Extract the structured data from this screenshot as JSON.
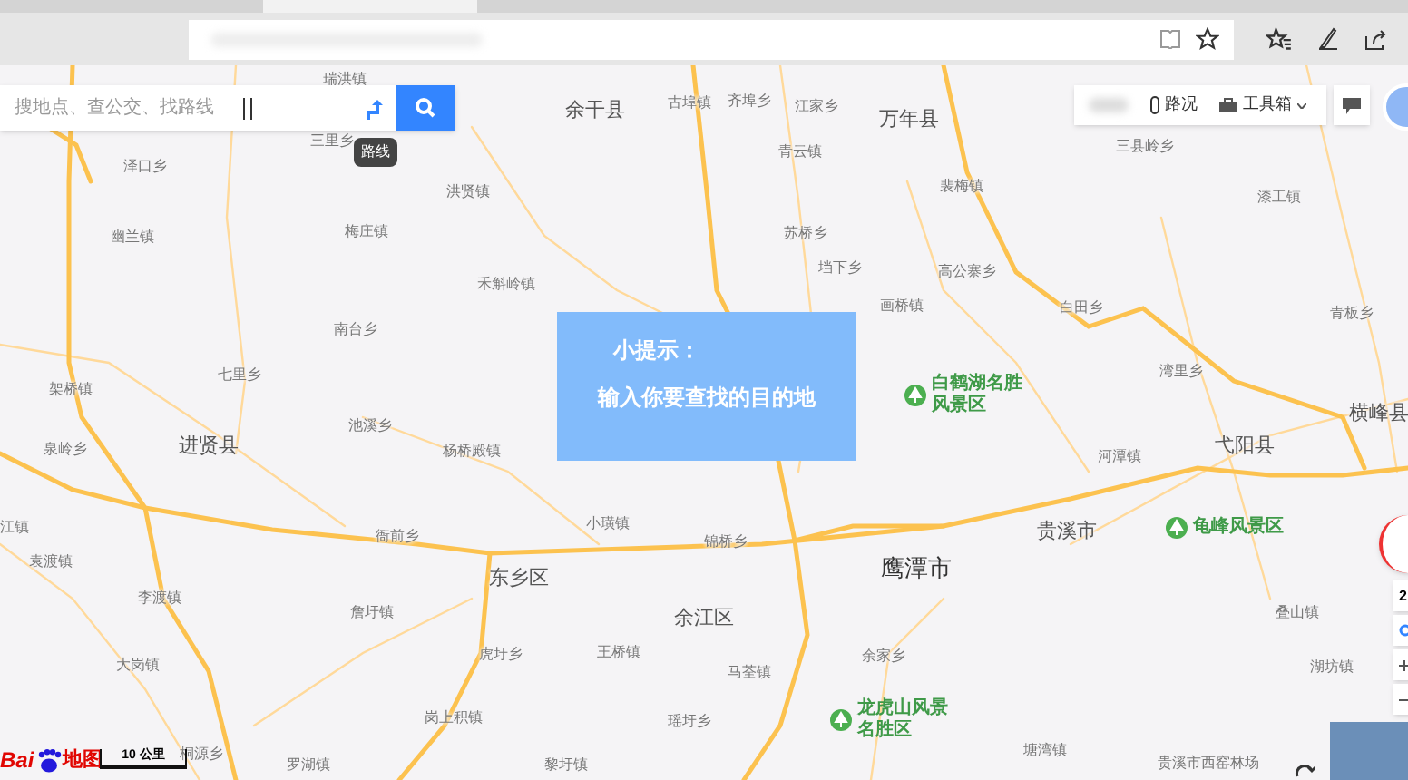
{
  "search": {
    "placeholder": "搜地点、查公交、找路线",
    "route_tooltip": "路线"
  },
  "top_panel": {
    "traffic": "路况",
    "toolbox": "工具箱"
  },
  "tip": {
    "title": "小提示：",
    "text": "输入你要查找的目的地"
  },
  "labels": [
    {
      "text": "瑞洪镇",
      "kind": "town"
    },
    {
      "text": "余干县",
      "kind": "county"
    },
    {
      "text": "古埠镇",
      "kind": "town"
    },
    {
      "text": "三里乡",
      "kind": "town"
    },
    {
      "text": "泽口乡",
      "kind": "town"
    },
    {
      "text": "洪贤镇",
      "kind": "town"
    },
    {
      "text": "幽兰镇",
      "kind": "town"
    },
    {
      "text": "梅庄镇",
      "kind": "town"
    },
    {
      "text": "齐埠乡",
      "kind": "town"
    },
    {
      "text": "江家乡",
      "kind": "town"
    },
    {
      "text": "万年县",
      "kind": "county"
    },
    {
      "text": "青云镇",
      "kind": "town"
    },
    {
      "text": "裴梅镇",
      "kind": "town"
    },
    {
      "text": "苏桥乡",
      "kind": "town"
    },
    {
      "text": "三县岭乡",
      "kind": "town"
    },
    {
      "text": "漆工镇",
      "kind": "town"
    },
    {
      "text": "禾斛岭镇",
      "kind": "town"
    },
    {
      "text": "南台乡",
      "kind": "town"
    },
    {
      "text": "七里乡",
      "kind": "town"
    },
    {
      "text": "架桥镇",
      "kind": "town"
    },
    {
      "text": "池溪乡",
      "kind": "town"
    },
    {
      "text": "泉岭乡",
      "kind": "town"
    },
    {
      "text": "进贤县",
      "kind": "county"
    },
    {
      "text": "杨桥殿镇",
      "kind": "town"
    },
    {
      "text": "垱下乡",
      "kind": "town"
    },
    {
      "text": "高公寨乡",
      "kind": "town"
    },
    {
      "text": "画桥镇",
      "kind": "town"
    },
    {
      "text": "白田乡",
      "kind": "town"
    },
    {
      "text": "青板乡",
      "kind": "town"
    },
    {
      "text": "湾里乡",
      "kind": "town"
    },
    {
      "text": "白鹤湖名胜风景区",
      "kind": "scenic"
    },
    {
      "text": "横峰县",
      "kind": "county"
    },
    {
      "text": "弋阳县",
      "kind": "county"
    },
    {
      "text": "河潭镇",
      "kind": "town"
    },
    {
      "text": "江镇",
      "kind": "town"
    },
    {
      "text": "袁渡镇",
      "kind": "town"
    },
    {
      "text": "李渡镇",
      "kind": "town"
    },
    {
      "text": "大岗镇",
      "kind": "town"
    },
    {
      "text": "桐源乡",
      "kind": "town"
    },
    {
      "text": "罗湖镇",
      "kind": "town"
    },
    {
      "text": "衙前乡",
      "kind": "town"
    },
    {
      "text": "小璜镇",
      "kind": "town"
    },
    {
      "text": "东乡区",
      "kind": "county"
    },
    {
      "text": "詹圩镇",
      "kind": "town"
    },
    {
      "text": "虎圩乡",
      "kind": "town"
    },
    {
      "text": "王桥镇",
      "kind": "town"
    },
    {
      "text": "岗上积镇",
      "kind": "town"
    },
    {
      "text": "余江区",
      "kind": "county"
    },
    {
      "text": "瑶圩乡",
      "kind": "town"
    },
    {
      "text": "黎圩镇",
      "kind": "town"
    },
    {
      "text": "锦桥乡",
      "kind": "town"
    },
    {
      "text": "鹰潭市",
      "kind": "city"
    },
    {
      "text": "贵溪市",
      "kind": "county"
    },
    {
      "text": "龟峰风景区",
      "kind": "scenic"
    },
    {
      "text": "余家乡",
      "kind": "town"
    },
    {
      "text": "马荃镇",
      "kind": "town"
    },
    {
      "text": "龙虎山风景名胜区",
      "kind": "scenic"
    },
    {
      "text": "叠山镇",
      "kind": "town"
    },
    {
      "text": "湖坊镇",
      "kind": "town"
    },
    {
      "text": "塘湾镇",
      "kind": "town"
    },
    {
      "text": "贵溪市西窑林场",
      "kind": "town"
    }
  ],
  "map_controls": {
    "mode": "2"
  },
  "logo": {
    "brand": "Bai",
    "product": "地图"
  },
  "scale": "10 公里"
}
